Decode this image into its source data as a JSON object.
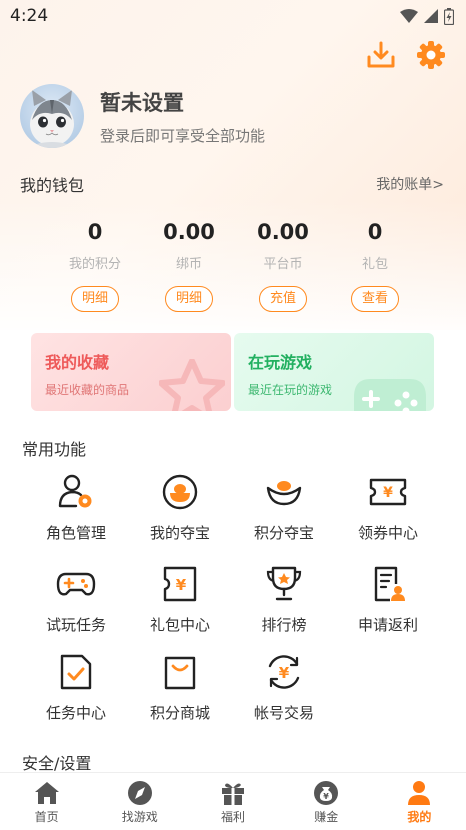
{
  "status_bar": {
    "time": "4:24"
  },
  "profile": {
    "name": "暂未设置",
    "subtitle": "登录后即可享受全部功能"
  },
  "wallet": {
    "title": "我的钱包",
    "bill_link": "我的账单>",
    "items": [
      {
        "value": "0",
        "label": "我的积分",
        "button": "明细"
      },
      {
        "value": "0.00",
        "label": "绑币",
        "button": "明细"
      },
      {
        "value": "0.00",
        "label": "平台币",
        "button": "充值"
      },
      {
        "value": "0",
        "label": "礼包",
        "button": "查看"
      }
    ]
  },
  "cards": {
    "favorites": {
      "title": "我的收藏",
      "subtitle": "最近收藏的商品"
    },
    "playing": {
      "title": "在玩游戏",
      "subtitle": "最近在玩的游戏"
    }
  },
  "functions": {
    "title": "常用功能",
    "items": [
      {
        "label": "角色管理",
        "icon": "role-icon"
      },
      {
        "label": "我的夺宝",
        "icon": "treasure-icon"
      },
      {
        "label": "积分夺宝",
        "icon": "ingot-icon"
      },
      {
        "label": "领券中心",
        "icon": "coupon-icon"
      },
      {
        "label": "试玩任务",
        "icon": "gamepad-icon"
      },
      {
        "label": "礼包中心",
        "icon": "gift-pack-icon"
      },
      {
        "label": "排行榜",
        "icon": "trophy-icon"
      },
      {
        "label": "申请返利",
        "icon": "rebate-icon"
      },
      {
        "label": "任务中心",
        "icon": "task-icon"
      },
      {
        "label": "积分商城",
        "icon": "shop-bag-icon"
      },
      {
        "label": "帐号交易",
        "icon": "exchange-icon"
      }
    ]
  },
  "security": {
    "title": "安全/设置"
  },
  "bottom_nav": {
    "items": [
      {
        "label": "首页",
        "icon": "home-icon"
      },
      {
        "label": "找游戏",
        "icon": "compass-icon"
      },
      {
        "label": "福利",
        "icon": "gift-icon"
      },
      {
        "label": "赚金",
        "icon": "money-bag-icon"
      },
      {
        "label": "我的",
        "icon": "user-icon",
        "active": true
      }
    ]
  },
  "colors": {
    "accent": "#ff8a1f",
    "active_nav": "#ff7a12",
    "fav_red": "#ee5a5a",
    "play_green": "#22b060"
  }
}
